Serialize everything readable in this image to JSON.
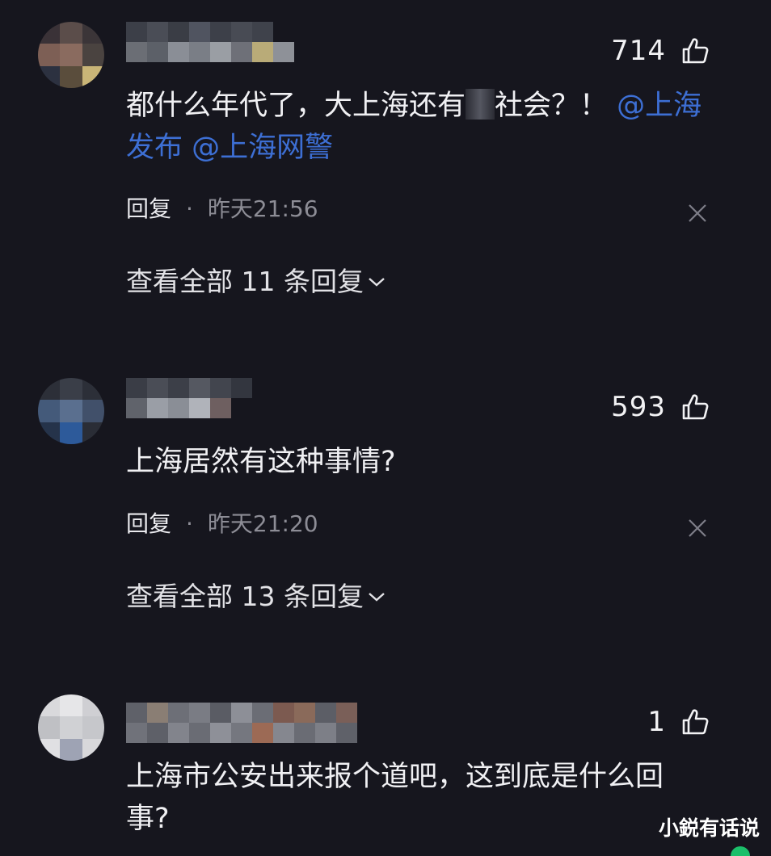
{
  "comments": [
    {
      "likes": "714",
      "text": "都什么年代了，大上海还有",
      "text_after": "社会？！",
      "mentions": [
        "@上海",
        "发布",
        "@上海网警"
      ],
      "reply_label": "回复",
      "separator": "·",
      "time": "昨天21:56",
      "view_replies": "查看全部 11 条回复"
    },
    {
      "likes": "593",
      "text": "上海居然有这种事情?",
      "reply_label": "回复",
      "separator": "·",
      "time": "昨天21:20",
      "view_replies": "查看全部 13 条回复"
    },
    {
      "likes": "1",
      "text": "上海市公安出来报个道吧，这到底是什么回事?"
    }
  ],
  "watermark": "小鋭有话说",
  "colors": {
    "background": "#16161e",
    "mention": "#3d6fd4",
    "muted": "#8d8d96",
    "badge": "#1bbf6a"
  },
  "icons": {
    "like": "thumbs-up-icon",
    "dismiss": "close-icon",
    "expand": "chevron-down-icon"
  }
}
